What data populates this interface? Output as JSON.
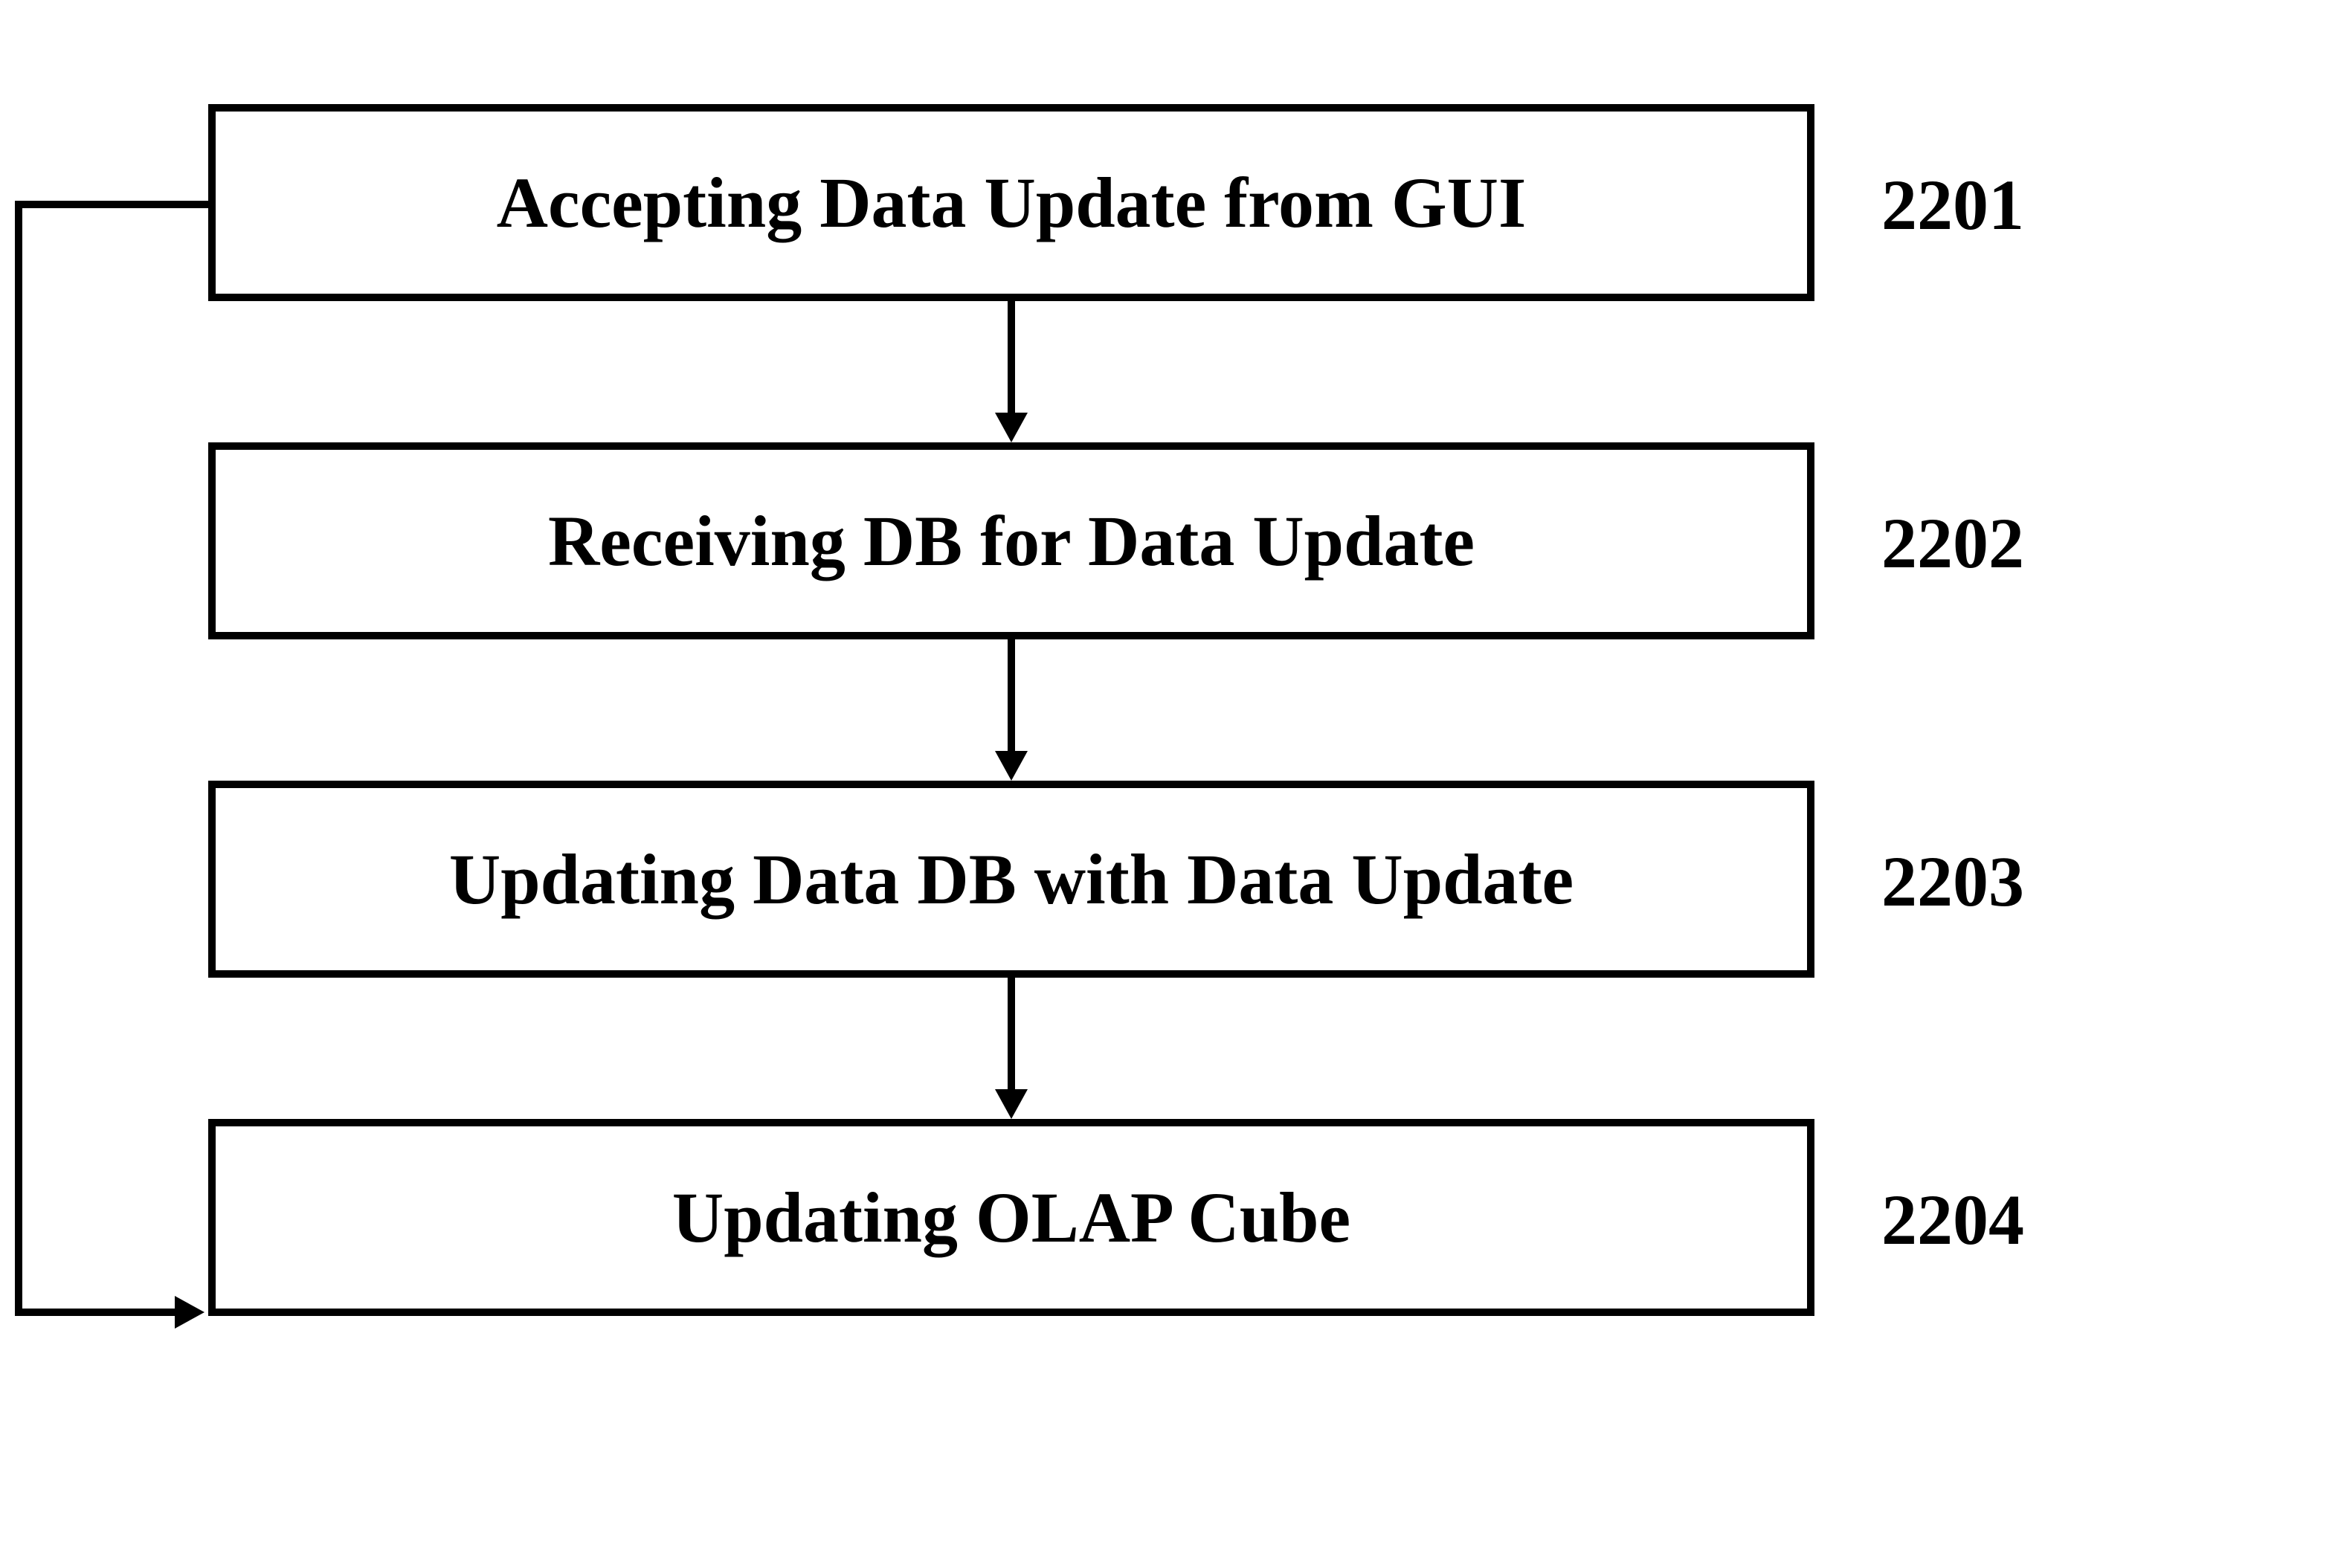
{
  "steps": [
    {
      "text": "Accepting Data Update from GUI",
      "label": "2201"
    },
    {
      "text": "Receiving DB for Data Update",
      "label": "2202"
    },
    {
      "text": "Updating Data DB with Data Update",
      "label": "2203"
    },
    {
      "text": "Updating OLAP Cube",
      "label": "2204"
    }
  ]
}
